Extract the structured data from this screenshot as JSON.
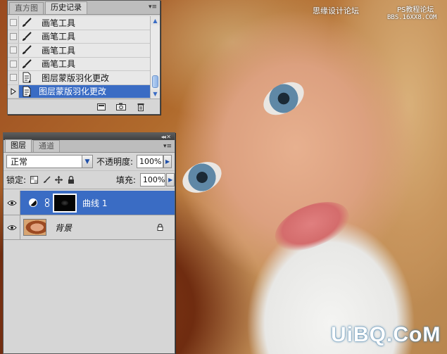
{
  "watermark": {
    "site_text": "思缘设计论坛",
    "site_text_2": "PS教程论坛",
    "url_text": "BBS.16XX8.COM",
    "logo_text": "UiBQ.CoM"
  },
  "history_panel": {
    "tabs": [
      "直方图",
      "历史记录"
    ],
    "active_tab": "历史记录",
    "items": [
      {
        "label": "画笔工具",
        "icon": "brush-icon",
        "selected": false
      },
      {
        "label": "画笔工具",
        "icon": "brush-icon",
        "selected": false
      },
      {
        "label": "画笔工具",
        "icon": "brush-icon",
        "selected": false
      },
      {
        "label": "画笔工具",
        "icon": "brush-icon",
        "selected": false
      },
      {
        "label": "图层蒙版羽化更改",
        "icon": "document-icon",
        "selected": false
      },
      {
        "label": "图层蒙版羽化更改",
        "icon": "document-icon",
        "selected": true
      }
    ],
    "footer_icons": [
      "new-document-from-state-icon",
      "camera-snapshot-icon",
      "trash-icon"
    ]
  },
  "layers_panel": {
    "tabs": [
      "图层",
      "通道"
    ],
    "active_tab": "图层",
    "blend_mode": "正常",
    "opacity_label": "不透明度:",
    "opacity_value": "100%",
    "lock_label": "锁定:",
    "fill_label": "填充:",
    "fill_value": "100%",
    "layers": [
      {
        "name": "曲线 1",
        "type": "curves-adjustment",
        "visible": true,
        "selected": true
      },
      {
        "name": "背景",
        "type": "background",
        "visible": true,
        "selected": false,
        "locked": true
      }
    ]
  },
  "colors": {
    "selection_blue": "#3a6cc4",
    "panel_gray": "#d6d6d6",
    "titlebar_dark": "#4a4a4a"
  }
}
